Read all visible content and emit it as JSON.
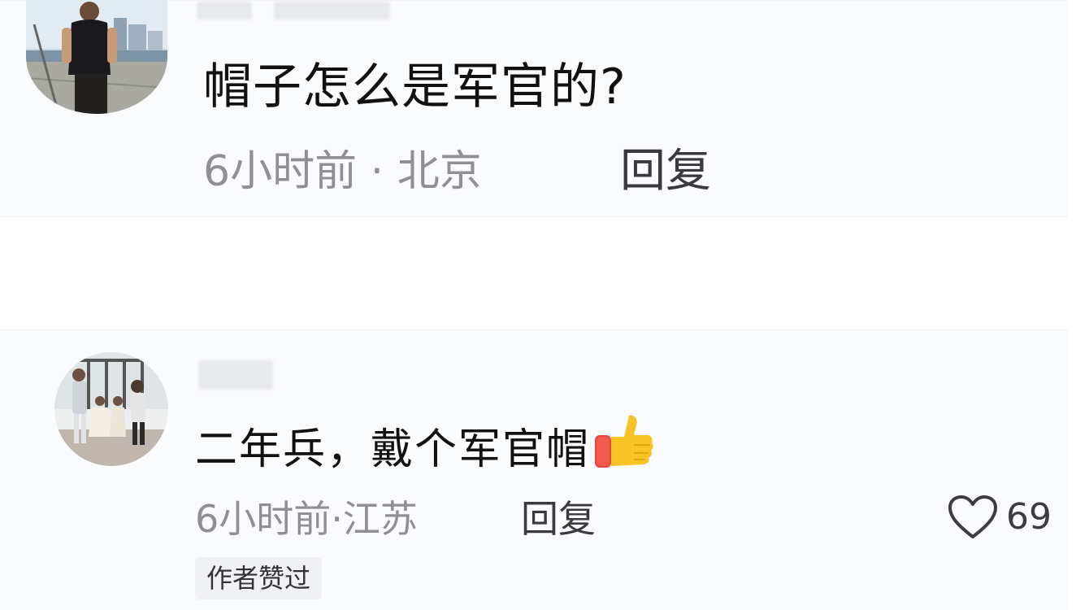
{
  "comments": [
    {
      "text": "帽子怎么是军官的?",
      "time": "6小时前",
      "location": "北京",
      "meta_separator": " · ",
      "reply_label": "回复"
    },
    {
      "text": "二年兵，戴个军官帽",
      "emoji_icon": "thumbs-up-icon",
      "time": "6小时前",
      "location": "江苏",
      "meta_separator": "·",
      "reply_label": "回复",
      "like_count": "69",
      "author_badge": "作者赞过"
    }
  ],
  "colors": {
    "card_background": "#fafbfd",
    "text_primary": "#111111",
    "text_meta": "#8f8f94",
    "badge_background": "#f0f1f3",
    "thumb_yellow": "#f7c325",
    "thumb_cuff": "#e8463e"
  }
}
